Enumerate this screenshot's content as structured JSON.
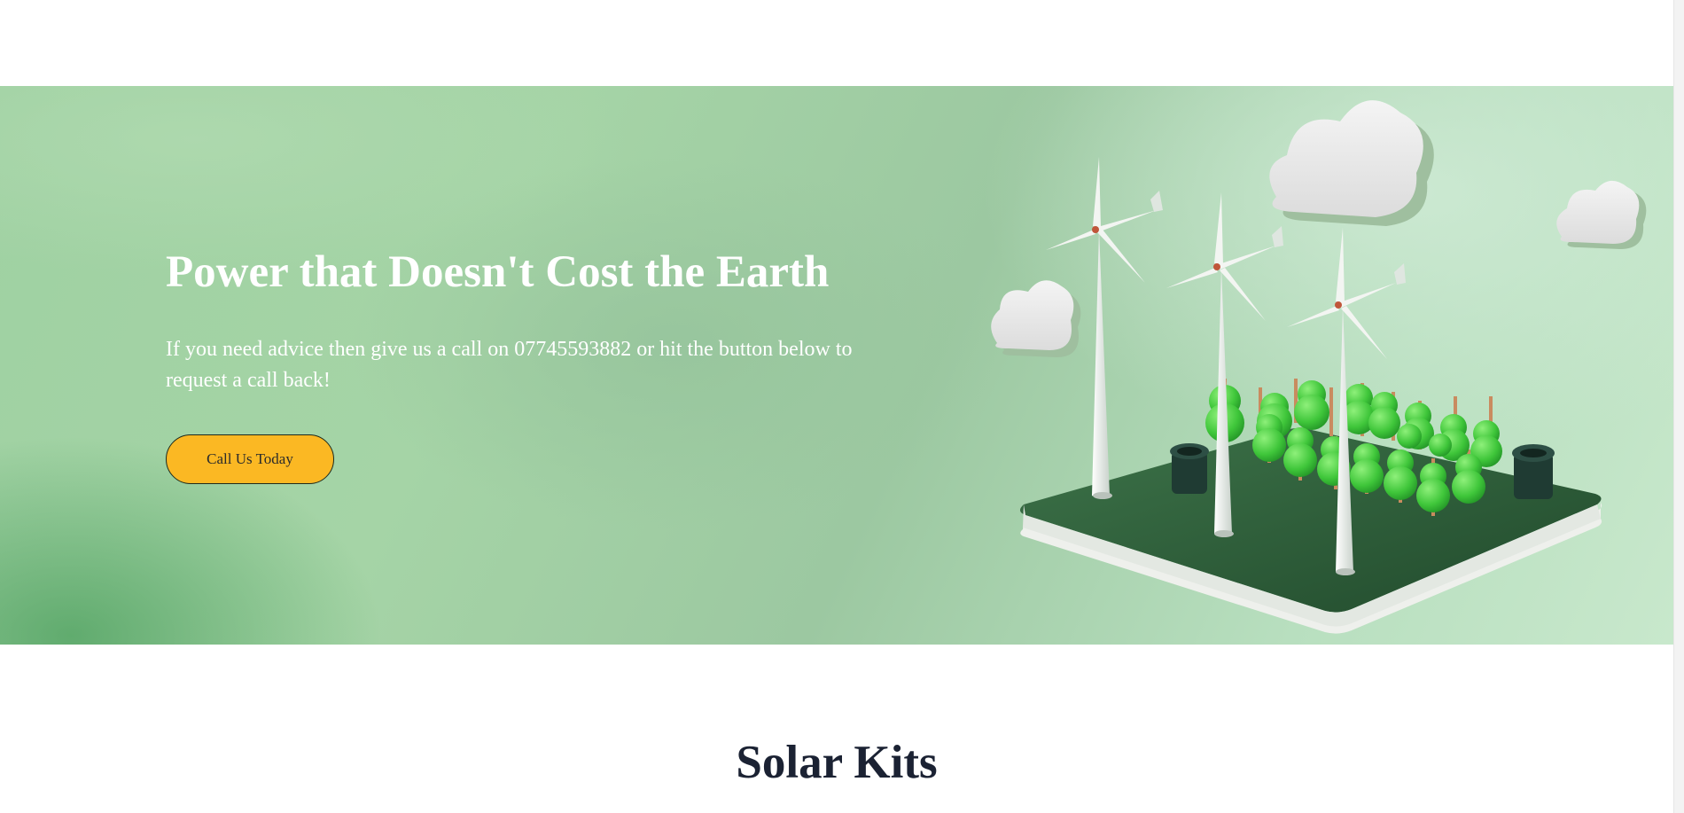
{
  "hero": {
    "title": "Power that Doesn't Cost the Earth",
    "text": "If you need advice then give us a call on 07745593882 or hit the button below to request a call back!",
    "button_label": "Call Us Today",
    "illustration": "wind-farm-illustration"
  },
  "section": {
    "title": "Solar Kits"
  },
  "colors": {
    "button": "#fbb823",
    "hero_green": "#9fd1a2",
    "heading_dark": "#1b2233"
  }
}
